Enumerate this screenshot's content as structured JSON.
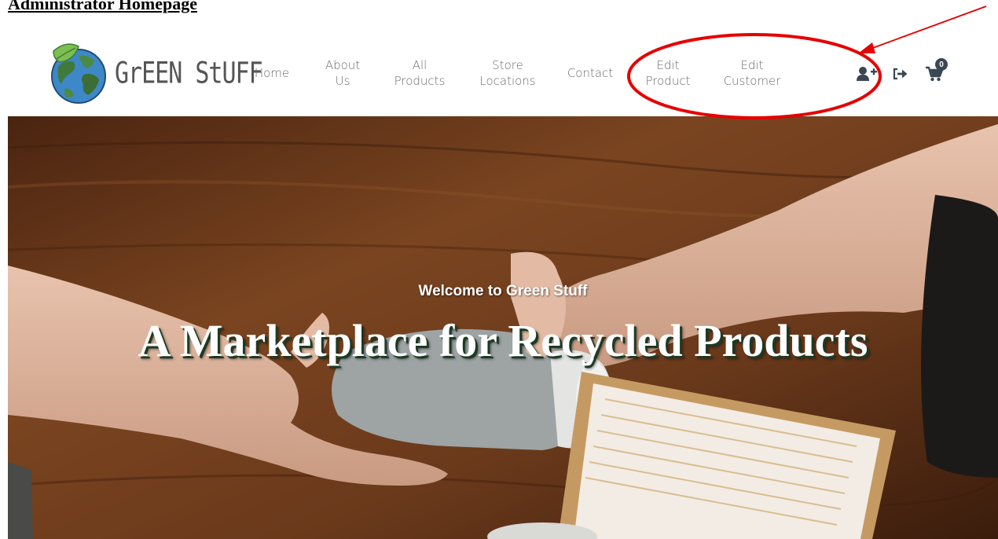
{
  "document": {
    "heading": "Administrator Homepage"
  },
  "navbar": {
    "brand": "Green Stuff",
    "brand_display": "GrEEN StUFF",
    "links": [
      {
        "id": "home",
        "label_lines": [
          "Home"
        ]
      },
      {
        "id": "about",
        "label_lines": [
          "About",
          "Us"
        ]
      },
      {
        "id": "all-products",
        "label_lines": [
          "All",
          "Products"
        ]
      },
      {
        "id": "store-locations",
        "label_lines": [
          "Store",
          "Locations"
        ]
      },
      {
        "id": "contact",
        "label_lines": [
          "Contact"
        ]
      },
      {
        "id": "edit-product",
        "label_lines": [
          "Edit",
          "Product"
        ]
      },
      {
        "id": "edit-customer",
        "label_lines": [
          "Edit",
          "Customer"
        ]
      }
    ],
    "icons": {
      "add_user": "user-plus-icon",
      "logout": "sign-out-icon",
      "cart": "shopping-cart-icon"
    },
    "cart_count": "0"
  },
  "hero": {
    "welcome": "Welcome to Green Stuff",
    "title": "A Marketplace for Recycled Products"
  },
  "colors": {
    "nav_text": "#6b6b6b",
    "annotation": "#e60000",
    "wood": "#6b3a1e",
    "badge": "#3a4752"
  }
}
